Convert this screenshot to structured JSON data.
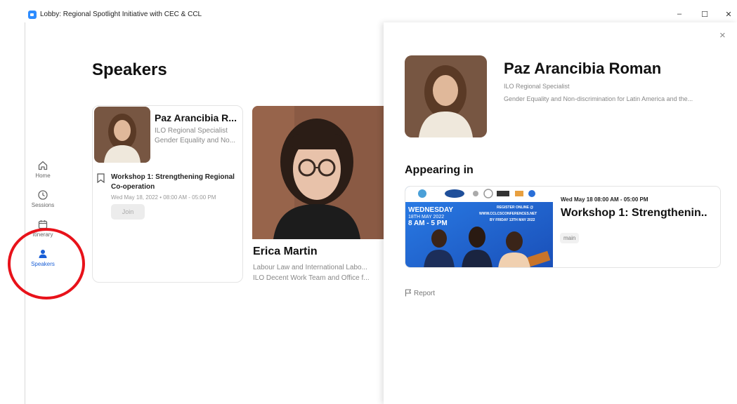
{
  "window": {
    "title": "Lobby: Regional Spotlight Initiative with CEC & CCL",
    "controls": {
      "minimize": "–",
      "maximize": "☐",
      "close": "✕"
    }
  },
  "nav": {
    "items": [
      {
        "label": "Home",
        "icon": "home-icon"
      },
      {
        "label": "Sessions",
        "icon": "clock-icon"
      },
      {
        "label": "Itinerary",
        "icon": "calendar-icon"
      },
      {
        "label": "Speakers",
        "icon": "person-icon",
        "active": true
      }
    ]
  },
  "page": {
    "title": "Speakers"
  },
  "speakers": [
    {
      "name": "Paz Arancibia R...",
      "role": "ILO Regional Specialist",
      "desc": "Gender Equality and No...",
      "session": {
        "title": "Workshop 1: Strengthening Regional Co-operation",
        "time": "Wed May 18, 2022 • 08:00 AM - 05:00 PM",
        "join_label": "Join"
      }
    },
    {
      "name": "Erica Martin",
      "role": "Labour Law and International Labo...",
      "desc": "ILO Decent Work Team and Office f..."
    }
  ],
  "panel": {
    "close": "×",
    "name": "Paz Arancibia Roman",
    "role": "ILO Regional Specialist",
    "desc": "Gender Equality and Non-discrimination for Latin America and the...",
    "appearing_heading": "Appearing in",
    "event": {
      "time": "Wed May 18 08:00 AM - 05:00 PM",
      "title": "Workshop 1: Strengthenin..",
      "tag": "main",
      "banner": {
        "day": "WEDNESDAY",
        "date": "18TH MAY 2022",
        "hours": "8 AM - 5 PM",
        "register_line1": "REGISTER ONLINE @",
        "register_line2": "WWW.CCLCSCONFERENCES.NET",
        "register_line3": "BY FRIDAY 13TH MAY 2022"
      }
    },
    "report_label": "Report"
  },
  "colors": {
    "accent": "#1a5fd6",
    "annotation": "#e8121a",
    "banner_bg": "#1f6fd8"
  }
}
